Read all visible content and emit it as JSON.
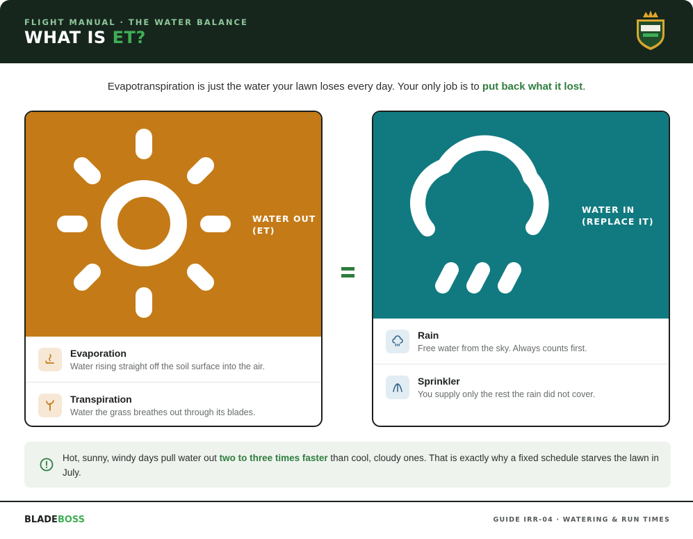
{
  "header": {
    "eyebrow": "FLIGHT MANUAL · THE WATER BALANCE",
    "title_main": "WHAT IS ",
    "title_accent": "ET?",
    "logo_text": "BLADE BOSS"
  },
  "intro": {
    "lead": "Evapotranspiration is just the water your lawn loses every day. Your only job is to ",
    "emphasis": "put back what it lost",
    "tail": "."
  },
  "water_out": {
    "label_line1": "WATER OUT",
    "label_line2": "(ET)",
    "hero_icon": "sun-icon",
    "color": "#c47a17",
    "items": [
      {
        "title": "Evaporation",
        "desc": "Water rising straight off the soil surface into the air.",
        "icon": "evaporation-icon"
      },
      {
        "title": "Transpiration",
        "desc": "Water the grass breathes out through its blades.",
        "icon": "grass-sprout-icon"
      }
    ]
  },
  "equals_sign": "=",
  "water_in": {
    "label_line1": "WATER IN",
    "label_line2": "(REPLACE IT)",
    "hero_icon": "rain-cloud-icon",
    "color": "#117a80",
    "items": [
      {
        "title": "Rain",
        "desc": "Free water from the sky. Always counts first.",
        "icon": "rain-icon"
      },
      {
        "title": "Sprinkler",
        "desc": "You supply only the rest the rain did not cover.",
        "icon": "sprinkler-icon"
      }
    ]
  },
  "tip": {
    "icon": "alert-circle-icon",
    "lead": "Hot, sunny, windy days pull water out ",
    "emphasis": "two to three times faster",
    "tail": " than cool, cloudy ones. That is exactly why a fixed schedule starves the lawn in July."
  },
  "footer": {
    "brand_part1": "BLADE",
    "brand_part2": "BOSS",
    "guide": "GUIDE IRR-04 · WATERING & RUN TIMES"
  },
  "colors": {
    "header_bg": "#16261d",
    "accent_green": "#3fae55",
    "text_green": "#2f7d3d"
  }
}
